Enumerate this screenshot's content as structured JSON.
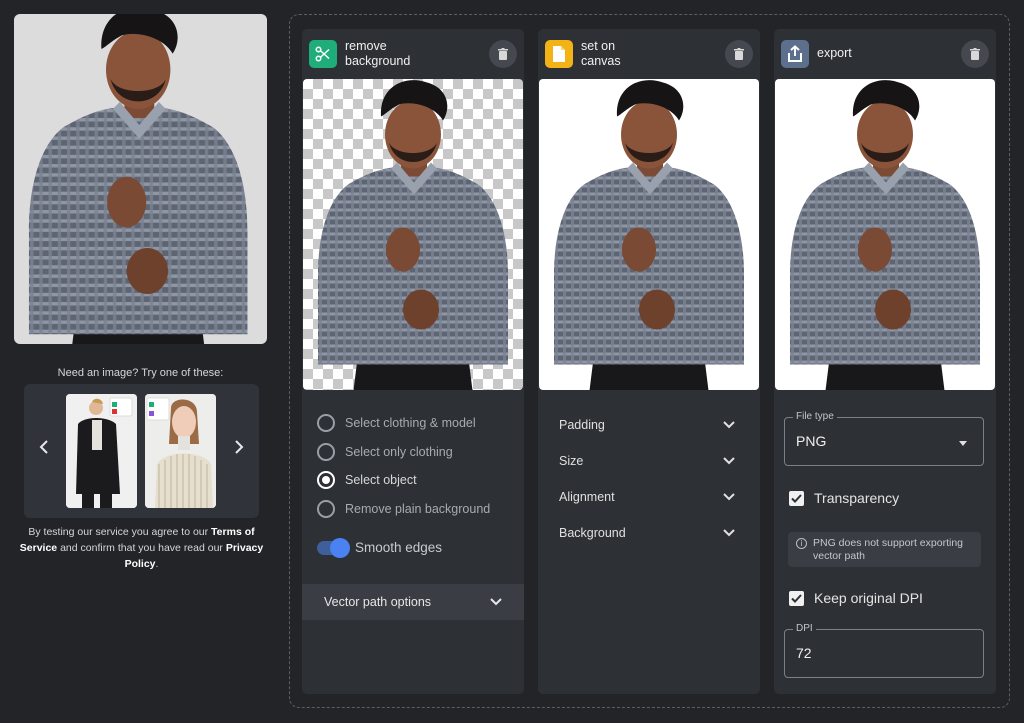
{
  "sidebar": {
    "sample_prompt": "Need an image? Try one of these:",
    "carousel_prev_icon": "chevron-left-icon",
    "carousel_next_icon": "chevron-right-icon",
    "terms": {
      "part1": "By testing our service you agree to our ",
      "link1": "Terms of Service",
      "part2": " and confirm that you have read our ",
      "link2": "Privacy Policy",
      "part3": "."
    }
  },
  "panels": {
    "remove_background": {
      "title": "remove\nbackground",
      "icon": "scissors-icon",
      "icon_color": "#1fae7a",
      "options": [
        {
          "label": "Select clothing & model",
          "selected": false
        },
        {
          "label": "Select only clothing",
          "selected": false
        },
        {
          "label": "Select object",
          "selected": true
        },
        {
          "label": "Remove plain background",
          "selected": false
        }
      ],
      "smooth_edges_label": "Smooth edges",
      "smooth_edges_on": true,
      "vector_path_label": "Vector path options"
    },
    "set_on_canvas": {
      "title": "set on\ncanvas",
      "icon": "file-icon",
      "icon_color": "#f3b316",
      "sections": [
        "Padding",
        "Size",
        "Alignment",
        "Background"
      ]
    },
    "export": {
      "title": "export",
      "icon": "upload-icon",
      "icon_color": "#5c6f8c",
      "file_type_label": "File type",
      "file_type_value": "PNG",
      "transparency_label": "Transparency",
      "transparency_checked": true,
      "note": "PNG does not support exporting vector path",
      "keep_dpi_label": "Keep original DPI",
      "keep_dpi_checked": true,
      "dpi_label": "DPI",
      "dpi_value": "72"
    }
  },
  "colors": {
    "background": "#222427",
    "panel": "#2d3035",
    "accent_toggle": "#4a82f2"
  }
}
